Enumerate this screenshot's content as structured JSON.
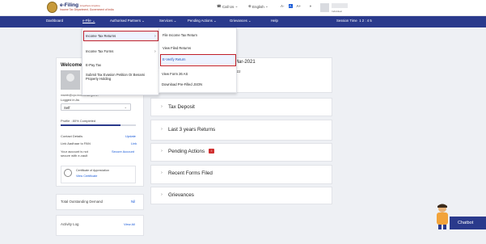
{
  "header": {
    "logo_title": "e-Filing",
    "logo_tagline": "Anywhere Anytime",
    "logo_sub": "Income Tax Department, Government of India",
    "call_label": "Call Us",
    "language_label": "English",
    "text_sizes": [
      "A-",
      "A",
      "A+"
    ],
    "contrast_icon": "contrast-icon",
    "user_type": "Individual"
  },
  "nav": {
    "items": [
      "Dashboard",
      "e-File",
      "Authorised Partners",
      "Services",
      "Pending Actions",
      "Grievances",
      "Help"
    ],
    "session_time_label": "Session Time",
    "session_time_value": "1 2 : 4 5"
  },
  "efile_menu": {
    "items": [
      "Income Tax Returns",
      "Income Tax Forms",
      "E-Pay Tax",
      "Submit Tax Evasion Petition Or Benami Property Holding"
    ]
  },
  "itr_submenu": {
    "items": [
      "File Income Tax Return",
      "View Filed Returns",
      "E-Verify Return",
      "View Form 26 AS",
      "Download Pre-Filled JSON"
    ]
  },
  "profile": {
    "welcome": "Welcome B",
    "email": "mseeb@cpc.incometax.gov.in",
    "logged_in_as_label": "Logged in As",
    "logged_in_as_value": "Self",
    "profile_completed": "Profile : 80% Completed",
    "profile_progress": 0.8,
    "contact_details": "Contact Details",
    "update": "Update",
    "link_aadhaar": "Link Aadhaar to PAN",
    "link": "Link",
    "secure_text_line1": "Your account is not",
    "secure_text_line2": "secure with e-vault",
    "secure_account": "Secure Account",
    "cert_title": "Certificate of Appreciation",
    "view_certificate": "View Certificate"
  },
  "outstanding": {
    "label": "Total Outstanding Demand",
    "value": "Nil"
  },
  "activity": {
    "label": "Activity Log",
    "view_all": "View All"
  },
  "main": {
    "date_fragment": "Mar-2021",
    "year_fragment": "022",
    "sections": [
      "Tax Deposit",
      "Last 3 years Returns",
      "Pending Actions",
      "Recent Forms Filed",
      "Grievances"
    ],
    "pending_badge": "!"
  },
  "chatbot": {
    "label": "Chatbot"
  },
  "colors": {
    "nav": "#2a3a8c",
    "highlight_border": "#c0202a",
    "link": "#1a5bd8"
  }
}
